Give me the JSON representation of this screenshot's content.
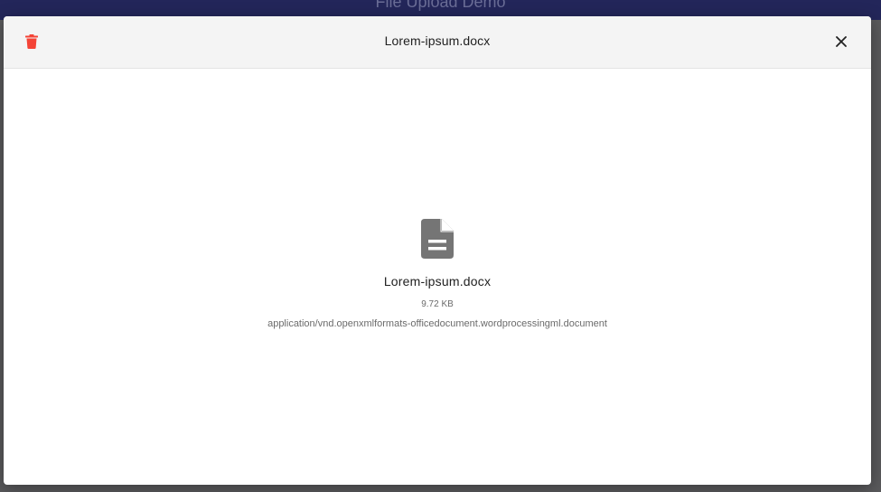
{
  "backdrop": {
    "title": "File Upload Demo"
  },
  "dialog": {
    "title": "Lorem-ipsum.docx",
    "delete_icon": "trash-icon",
    "close_icon": "close-icon",
    "delete_color": "#f44336"
  },
  "preview": {
    "icon": "document-icon",
    "file_name": "Lorem-ipsum.docx",
    "file_size": "9.72 KB",
    "mime_type": "application/vnd.openxmlformats-officedocument.wordprocessingml.document"
  }
}
